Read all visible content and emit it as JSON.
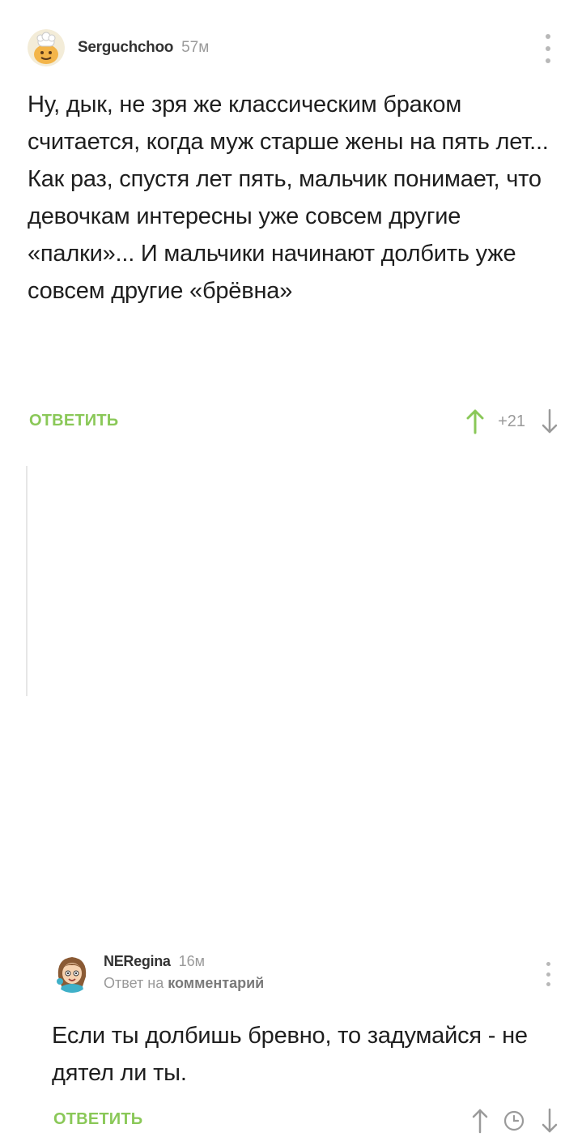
{
  "colors": {
    "accent_green": "#8ac858",
    "muted": "#9a9a9a",
    "text": "#1e1e1e"
  },
  "comments": [
    {
      "username": "Serguchchoo",
      "time": "57м",
      "avatar_icon": "chef-avatar",
      "paragraphs": [
        "Ну, дык, не зря же классическим браком считается, когда муж старше жены на пять лет...",
        "Как раз, спустя лет пять, мальчик понимает, что девочкам интересны уже совсем другие «палки»... И мальчики начинают долбить уже совсем другие «брёвна»"
      ],
      "reply_label": "ОТВЕТИТЬ",
      "score": "+21",
      "upvote_color": "#8ac858"
    },
    {
      "username": "NERegina",
      "time": "16м",
      "avatar_icon": "cartoon-girl-avatar",
      "reply_to_prefix": "Ответ на",
      "reply_to_link": "комментарий",
      "paragraphs": [
        "Если ты долбишь бревно, то задумайся - не дятел ли ты."
      ],
      "reply_label": "ОТВЕТИТЬ"
    }
  ]
}
